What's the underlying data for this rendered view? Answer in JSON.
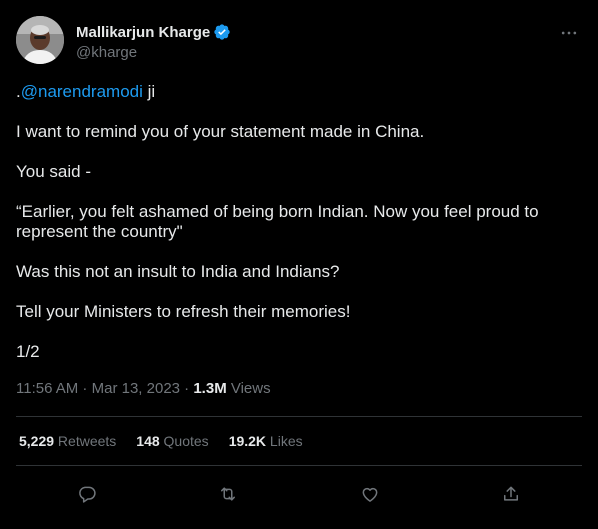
{
  "author": {
    "name": "Mallikarjun Kharge",
    "handle": "@kharge",
    "verified_color": "#1d9bf0"
  },
  "tweet": {
    "prefix": ".",
    "mention": "@narendramodi",
    "mention_suffix": " ji",
    "line2": "I want to remind you of your statement made in China.",
    "line3": "You said -",
    "line4": "“Earlier, you felt ashamed of being born Indian. Now you feel proud to represent the country\"",
    "line5": "Was this not an insult to India and Indians?",
    "line6": "Tell your Ministers to refresh their memories!",
    "line7": "1/2"
  },
  "meta": {
    "time": "11:56 AM",
    "separator": " · ",
    "date": "Mar 13, 2023",
    "separator2": " · ",
    "views_count": "1.3M",
    "views_label": " Views"
  },
  "stats": [
    {
      "count": "5,229",
      "label": " Retweets"
    },
    {
      "count": "148",
      "label": " Quotes"
    },
    {
      "count": "19.2K",
      "label": " Likes"
    }
  ],
  "actions": [
    "reply-icon",
    "retweet-icon",
    "like-icon",
    "share-icon"
  ],
  "colors": {
    "background": "#000000",
    "text": "#e7e9ea",
    "secondary": "#71767b",
    "accent": "#1d9bf0",
    "divider": "#2f3336"
  }
}
